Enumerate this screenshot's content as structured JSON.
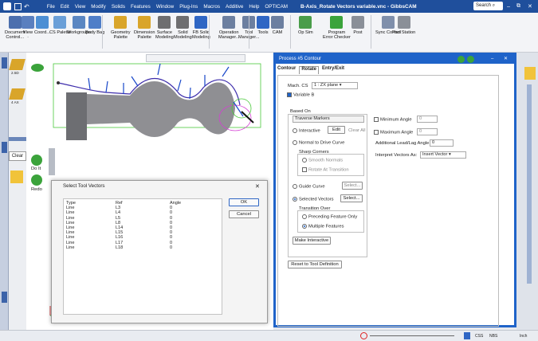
{
  "app": {
    "menu": [
      "File",
      "Edit",
      "View",
      "Modify",
      "Solids",
      "Features",
      "Window",
      "Plug-Ins",
      "Macros",
      "Additive",
      "Help",
      "OPTICAM"
    ],
    "title": "B-Axis_Rotate Vectors variable.vnc - GibbsCAM",
    "search_label": "Search",
    "search_icon": "magnifier",
    "window_controls": [
      "–",
      "⧉",
      "✕"
    ]
  },
  "ribbon": {
    "buttons": [
      {
        "label": "Document\nControl...",
        "icon": "document-icon"
      },
      {
        "label": "View\n·",
        "icon": "view-icon"
      },
      {
        "label": "Coord...",
        "icon": "coord-icon"
      },
      {
        "label": "CS Palette",
        "icon": "cs-palette-icon"
      },
      {
        "label": "Workgroups",
        "icon": "workgroups-icon"
      },
      {
        "label": "Body Bag",
        "icon": "body-bag-icon"
      },
      {
        "label": "Geometry\nPalette",
        "icon": "geometry-icon"
      },
      {
        "label": "Dimension\nPalette",
        "icon": "dimension-icon"
      },
      {
        "label": "Surface\nModeling",
        "icon": "surface-icon"
      },
      {
        "label": "Solid\nModeling",
        "icon": "solid-icon"
      },
      {
        "label": "FB Solid\nModeling",
        "icon": "fb-solid-icon"
      },
      {
        "label": "Operation\nManager...",
        "icon": "operation-icon"
      },
      {
        "label": "Tool\nManager...",
        "icon": "tool-icon"
      },
      {
        "label": "Tools",
        "icon": "tools-icon"
      },
      {
        "label": "CAM",
        "icon": "cam-icon"
      },
      {
        "label": "Op Sim",
        "icon": "opsim-icon"
      },
      {
        "label": "Program\nError Checker",
        "icon": "program-icon"
      },
      {
        "label": "Post",
        "icon": "post-icon"
      },
      {
        "label": "Sync Control",
        "icon": "sync-icon"
      },
      {
        "label": "Part Station",
        "icon": "part-station-icon"
      }
    ]
  },
  "left_tools": {
    "do_it": "Do It",
    "redo": "Redo",
    "clear": "Clear",
    "labels": [
      "2.5D",
      "4 AX"
    ]
  },
  "process": {
    "title": "Process #5 Contour",
    "tabs": [
      "Contour",
      "Rotate",
      "Entry/Exit"
    ],
    "mach_cs_label": "Mach. CS",
    "mach_cs_value": "1 : ZX plane",
    "variable_b": "Variable B",
    "based_on": "Based On",
    "traverse_markers": "Traverse Markers",
    "interactive": "Interactive",
    "edit": "Edit",
    "clear_all": "Clear All",
    "normal_to_drive": "Normal to Drive Curve",
    "sharp_corners": "Sharp Corners",
    "smooth_normals": "Smooth Normals",
    "rotate_at_transition": "Rotate At Transition",
    "guide_curve": "Guide Curve",
    "select_dots": "Select...",
    "selected_vectors": "Selected Vectors",
    "transition_over": "Transition Over",
    "preceding_feature": "Preceding Feature Only",
    "multiple_features": "Multiple Features",
    "make_interactive": "Make Interactive",
    "reset_tool_def": "Reset to Tool Definition",
    "minimum_angle": "Minimum Angle",
    "maximum_angle": "Maximum Angle",
    "min_value": "0",
    "max_value": "0",
    "additional_lead": "Additional Lead/Lag Angle",
    "lead_value": "0",
    "interpret_as": "Interpret Vectors As:",
    "interpret_value": "Insert Vector"
  },
  "dialog": {
    "title": "Select Tool Vectors",
    "close_label": "✕",
    "columns": [
      "Type",
      "Ref",
      "Angle"
    ],
    "rows": [
      [
        "Line",
        "L3",
        "0"
      ],
      [
        "Line",
        "L4",
        "0"
      ],
      [
        "Line",
        "L5",
        "0"
      ],
      [
        "Line",
        "L8",
        "0"
      ],
      [
        "Line",
        "L14",
        "0"
      ],
      [
        "Line",
        "L15",
        "0"
      ],
      [
        "Line",
        "L16",
        "0"
      ],
      [
        "Line",
        "L17",
        "0"
      ],
      [
        "Line",
        "L18",
        "0"
      ]
    ],
    "ok": "OK",
    "cancel": "Cancel"
  },
  "status": {
    "items": [
      "CSS",
      "NBS"
    ],
    "right": "Inch"
  },
  "colors": {
    "title": "#1f4f9c",
    "panel": "#1f63c9",
    "part": "#8f8f93",
    "vector": "#1847c9",
    "profile": "#3c2cab",
    "rapid": "#d43fd3",
    "bound": "#4ac93b"
  }
}
